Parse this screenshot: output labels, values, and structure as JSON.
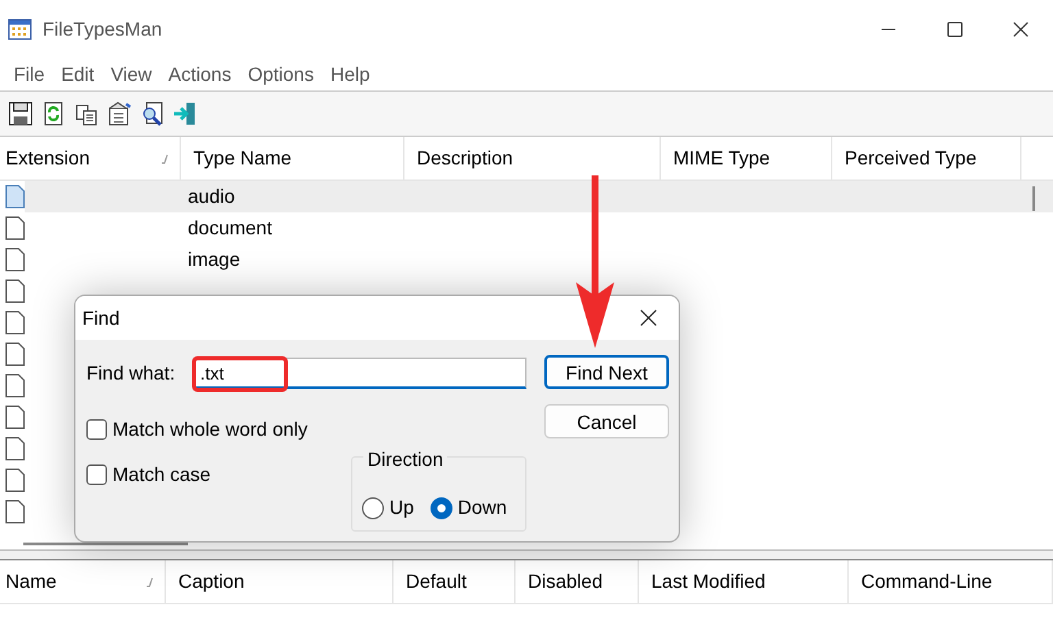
{
  "window": {
    "title": "FileTypesMan"
  },
  "menu": [
    "File",
    "Edit",
    "View",
    "Actions",
    "Options",
    "Help"
  ],
  "toolbar": [
    {
      "kind": "save"
    },
    {
      "kind": "refresh"
    },
    {
      "kind": "copy"
    },
    {
      "kind": "properties"
    },
    {
      "kind": "find"
    },
    {
      "kind": "exit"
    }
  ],
  "table": {
    "columns": [
      {
        "label": "Extension",
        "sorted": true
      },
      {
        "label": "Type Name",
        "sorted": false
      },
      {
        "label": "Description",
        "sorted": false
      },
      {
        "label": "MIME Type",
        "sorted": false
      },
      {
        "label": "Perceived Type",
        "sorted": false
      }
    ],
    "rows": [
      {
        "type_name": "audio",
        "selected": true
      },
      {
        "type_name": "document",
        "selected": false
      },
      {
        "type_name": "image",
        "selected": false
      },
      {
        "selected": false
      },
      {
        "selected": false
      },
      {
        "selected": false
      },
      {
        "selected": false
      },
      {
        "selected": false
      },
      {
        "selected": false
      },
      {
        "selected": false
      },
      {
        "selected": false
      }
    ]
  },
  "lower_table": {
    "columns": [
      {
        "label": "Name",
        "sorted": true
      },
      {
        "label": "Caption",
        "sorted": false
      },
      {
        "label": "Default",
        "sorted": false
      },
      {
        "label": "Disabled",
        "sorted": false
      },
      {
        "label": "Last Modified",
        "sorted": false
      },
      {
        "label": "Command-Line",
        "sorted": false
      }
    ]
  },
  "find_dialog": {
    "title": "Find",
    "find_what_label": "Find what:",
    "find_what_value": ".txt",
    "options": [
      {
        "label": "Match whole word only",
        "checked": false
      },
      {
        "label": "Match case",
        "checked": false
      }
    ],
    "direction": {
      "label": "Direction",
      "choices": [
        {
          "label": "Up",
          "selected": false
        },
        {
          "label": "Down",
          "selected": true
        }
      ]
    },
    "buttons": [
      {
        "label": "Find Next",
        "default": true
      },
      {
        "label": "Cancel",
        "default": false
      }
    ]
  }
}
